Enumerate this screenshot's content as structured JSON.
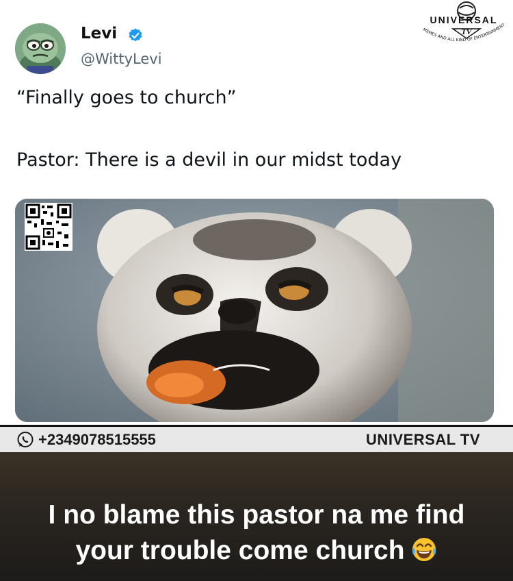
{
  "tweet": {
    "user_name": "Levi",
    "handle": "@WittyLevi",
    "line_1": "“Finally goes to church”",
    "line_2": "Pastor: There is a devil in our midst today"
  },
  "logo": {
    "title": "UNIVERSAL",
    "subtitle": "TV",
    "tagline": "MEMES AND ALL KIND OF ENTERTAINMENT"
  },
  "footer": {
    "phone": "+2349078515555",
    "brand": "UNIVERSAL TV"
  },
  "caption": {
    "line_1": "I no blame this pastor na me find",
    "line_2": "your trouble come church"
  },
  "icons": {
    "verified": "verified-badge-icon",
    "whatsapp": "whatsapp-icon",
    "emoji": "tears-of-joy-emoji"
  },
  "colors": {
    "verified_blue": "#1d9bf0",
    "handle_gray": "#536471",
    "footer_bg": "#e8e8e8",
    "caption_bg": "#2a2520"
  }
}
